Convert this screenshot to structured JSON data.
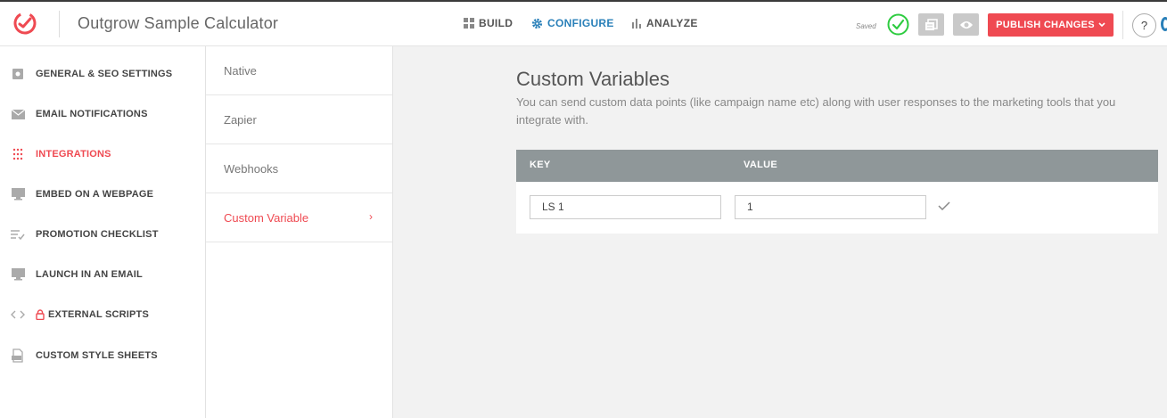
{
  "app": {
    "title": "Outgrow Sample Calculator"
  },
  "nav": [
    {
      "label": "BUILD",
      "icon": "grid-icon",
      "active": false
    },
    {
      "label": "CONFIGURE",
      "icon": "gear-icon",
      "active": true
    },
    {
      "label": "ANALYZE",
      "icon": "bar-chart-icon",
      "active": false
    }
  ],
  "status": {
    "saved": "Saved"
  },
  "actions": {
    "publish": "PUBLISH CHANGES",
    "help": "?"
  },
  "sidebar": {
    "items": [
      {
        "label": "GENERAL & SEO SETTINGS",
        "icon": "settings-icon"
      },
      {
        "label": "EMAIL NOTIFICATIONS",
        "icon": "envelope-icon"
      },
      {
        "label": "INTEGRATIONS",
        "icon": "dots-grid-icon",
        "active": true
      },
      {
        "label": "EMBED ON A WEBPAGE",
        "icon": "monitor-icon"
      },
      {
        "label": "PROMOTION CHECKLIST",
        "icon": "checklist-icon"
      },
      {
        "label": "LAUNCH IN AN EMAIL",
        "icon": "monitor-icon"
      },
      {
        "label": "EXTERNAL SCRIPTS",
        "icon": "code-icon",
        "locked": true
      },
      {
        "label": "CUSTOM STYLE SHEETS",
        "icon": "css-file-icon"
      }
    ]
  },
  "subnav": {
    "items": [
      {
        "label": "Native"
      },
      {
        "label": "Zapier"
      },
      {
        "label": "Webhooks"
      },
      {
        "label": "Custom Variable",
        "active": true
      }
    ],
    "chevron": "›"
  },
  "main": {
    "title": "Custom Variables",
    "description": "You can send custom data points (like campaign name etc) along with user responses to the marketing tools that you integrate with.",
    "table": {
      "headers": {
        "key": "KEY",
        "value": "VALUE"
      },
      "rows": [
        {
          "key": "LS 1",
          "value": "1"
        }
      ]
    }
  },
  "colors": {
    "accent": "#ef4a52",
    "link": "#2a80b9",
    "success": "#2ecc40",
    "header": "#8f9799"
  }
}
